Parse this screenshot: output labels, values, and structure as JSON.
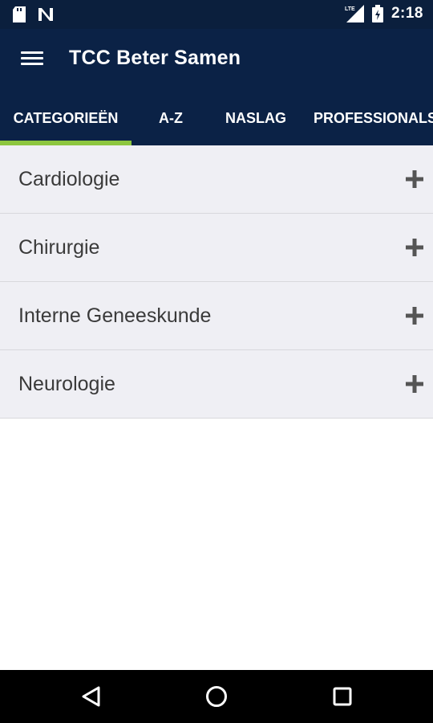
{
  "status_bar": {
    "time": "2:18",
    "icons": [
      "sd-card-icon",
      "n-notification-icon",
      "lte-signal-icon",
      "battery-charging-icon"
    ]
  },
  "app_bar": {
    "title": "TCC Beter Samen",
    "menu_icon": "hamburger-menu-icon"
  },
  "tabs": [
    {
      "label": "CATEGORIEËN",
      "active": true
    },
    {
      "label": "A-Z",
      "active": false
    },
    {
      "label": "NASLAG",
      "active": false
    },
    {
      "label": "PROFESSIONALS",
      "active": false
    }
  ],
  "categories": [
    {
      "label": "Cardiologie",
      "icon": "plus-icon"
    },
    {
      "label": "Chirurgie",
      "icon": "plus-icon"
    },
    {
      "label": "Interne Geneeskunde",
      "icon": "plus-icon"
    },
    {
      "label": "Neurologie",
      "icon": "plus-icon"
    }
  ],
  "nav_bar": {
    "icons": [
      "back-icon",
      "home-icon",
      "recents-icon"
    ]
  },
  "colors": {
    "status_bar": "#0b1f3d",
    "app_bar": "#0b2246",
    "tab_indicator": "#8dc63f",
    "list_bg": "#efeff4",
    "list_text": "#3a3a3a",
    "plus": "#555555"
  }
}
